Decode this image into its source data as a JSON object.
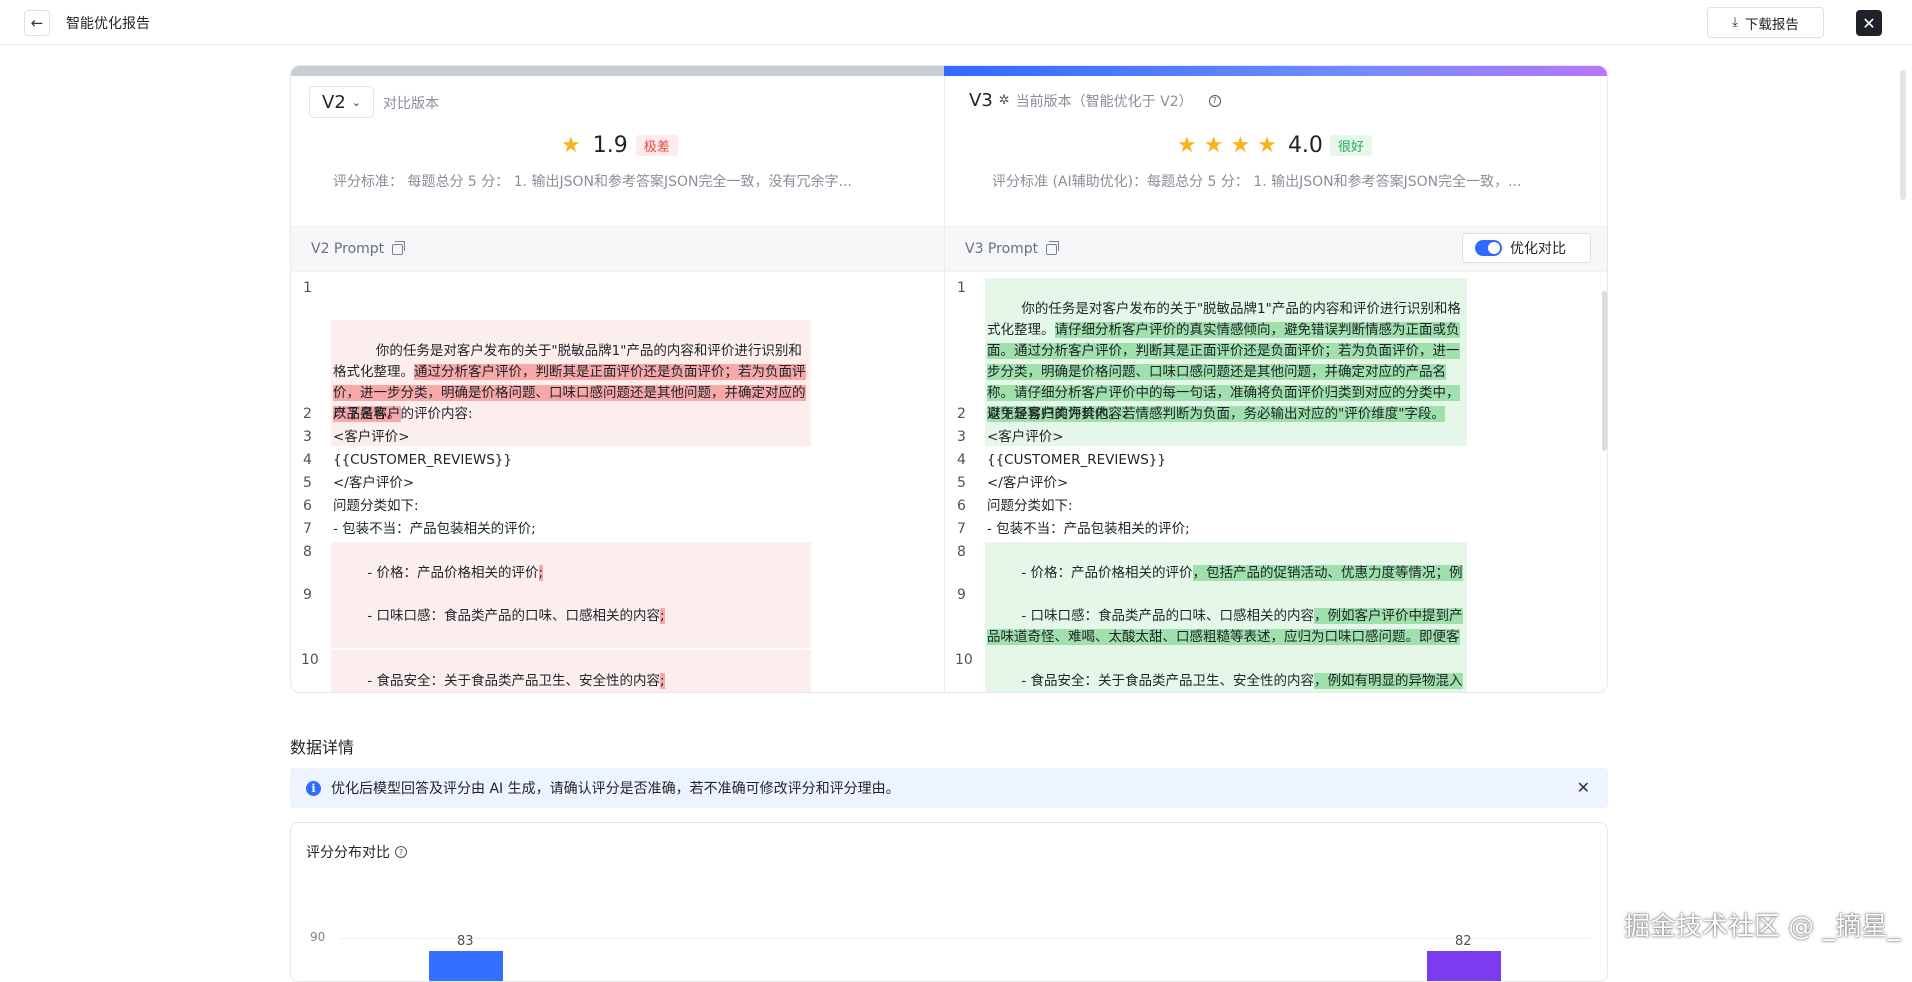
{
  "header": {
    "back_icon": "←",
    "title": "智能优化报告",
    "download_label": "下载报告",
    "download_icon": "⤓",
    "close_icon": "✕"
  },
  "left": {
    "version": "V2",
    "version_caption": "对比版本",
    "score": "1.9",
    "stars": 1,
    "rating_badge": "极差",
    "criteria": "评分标准：  每题总分 5 分：  1. 输出JSON和参考答案JSON完全一致，没有冗余字...",
    "prompt_label": "V2 Prompt",
    "lines": [
      {
        "n": "1",
        "text": "你的任务是对客户发布的关于\"脱敏品牌1\"产品的内容和评价进行识别和格式化整理。",
        "hl": "通过分析客户评价，判断其是正面评价还是负面评价；若为负面评价，进一步分类，明确是价格问题、口味口感问题还是其他问题，并确定对应的产品名称。"
      },
      {
        "n": "2",
        "text": "以下是客户的评价内容:"
      },
      {
        "n": "3",
        "text": "<客户评价>"
      },
      {
        "n": "4",
        "text": "{{CUSTOMER_REVIEWS}}"
      },
      {
        "n": "5",
        "text": "</客户评价>"
      },
      {
        "n": "6",
        "text": "问题分类如下:"
      },
      {
        "n": "7",
        "text": "- 包装不当：产品包装相关的评价;"
      },
      {
        "n": "8",
        "text": "- 价格：产品价格相关的评价",
        "hl": ";"
      },
      {
        "n": "9",
        "text": "- 口味口感：食品类产品的口味、口感相关的内容",
        "hl": ";"
      },
      {
        "n": "10",
        "text": "- 食品安全：关于食品类产品卫生、安全性的内容",
        "hl": ";"
      }
    ]
  },
  "right": {
    "version": "V3",
    "version_caption": "当前版本（智能优化于 V2）",
    "score": "4.0",
    "stars": 4,
    "rating_badge": "很好",
    "criteria": "评分标准 (AI辅助优化)：每题总分 5 分：  1. 输出JSON和参考答案JSON完全一致，...",
    "prompt_label": "V3 Prompt",
    "toggle_label": "优化对比",
    "lines": [
      {
        "n": "1",
        "text": "你的任务是对客户发布的关于\"脱敏品牌1\"产品的内容和评价进行识别和格式化整理。",
        "hl": "请仔细分析客户评价的真实情感倾向，避免错误判断情感为正面或负面。通过分析客户评价，判断其是正面评价还是负面评价；若为负面评价，进一步分类，明确是价格问题、口味口感问题还是其他问题，并确定对应的产品名称。请仔细分析客户评价中的每一句话，准确将负面评价归类到对应的分类中，避免轻易归类为其他。若情感判断为负面，务必输出对应的\"评价维度\"字段。"
      },
      {
        "n": "2",
        "text": "以下是客户的评价内容:"
      },
      {
        "n": "3",
        "text": "<客户评价>"
      },
      {
        "n": "4",
        "text": "{{CUSTOMER_REVIEWS}}"
      },
      {
        "n": "5",
        "text": "</客户评价>"
      },
      {
        "n": "6",
        "text": "问题分类如下:"
      },
      {
        "n": "7",
        "text": "- 包装不当：产品包装相关的评价;"
      },
      {
        "n": "8",
        "text": "- 价格：产品价格相关的评价",
        "hl": "，包括产品的促销活动、优惠力度等情况；例如客户提到产品活动提前结束、优惠力度不够等表述，应归为价格问题。"
      },
      {
        "n": "9",
        "text": "- 口味口感：食品类产品的口味、口感相关的内容",
        "hl": "，例如客户评价中提到产品味道奇怪、难喝、太酸太甜、口感粗糙等表述，应归为口味口感问题。即便客户怀疑变质，但仅从口味口感的异常描述判断，应归为口味口感问题。"
      },
      {
        "n": "10",
        "text": "- 食品安全：关于食品类产品卫生、安全性的内容",
        "hl": "，例如有明显的异物混入产生的异味、经过专业检测确定的变质异味、细菌超标等情况属于食品安全问题。"
      }
    ]
  },
  "details": {
    "title": "数据详情",
    "banner": "优化后模型回答及评分由 AI 生成，请确认评分是否准确，若不准确可修改评分和评分理由。",
    "banner_close": "✕",
    "info_icon": "i"
  },
  "chart_data": {
    "type": "bar",
    "title": "评分分布对比",
    "y_tick": "90",
    "series": [
      {
        "value": 83,
        "label": "83",
        "color": "#3370ff"
      },
      {
        "value": 82,
        "label": "82",
        "color": "#7b3cf0"
      }
    ]
  },
  "watermark": "掘金技术社区 @ _摘星_",
  "colors": {
    "accent": "#2f6bff",
    "star": "#f6b51e",
    "bad": "#e5483d",
    "good": "#1fae51"
  }
}
